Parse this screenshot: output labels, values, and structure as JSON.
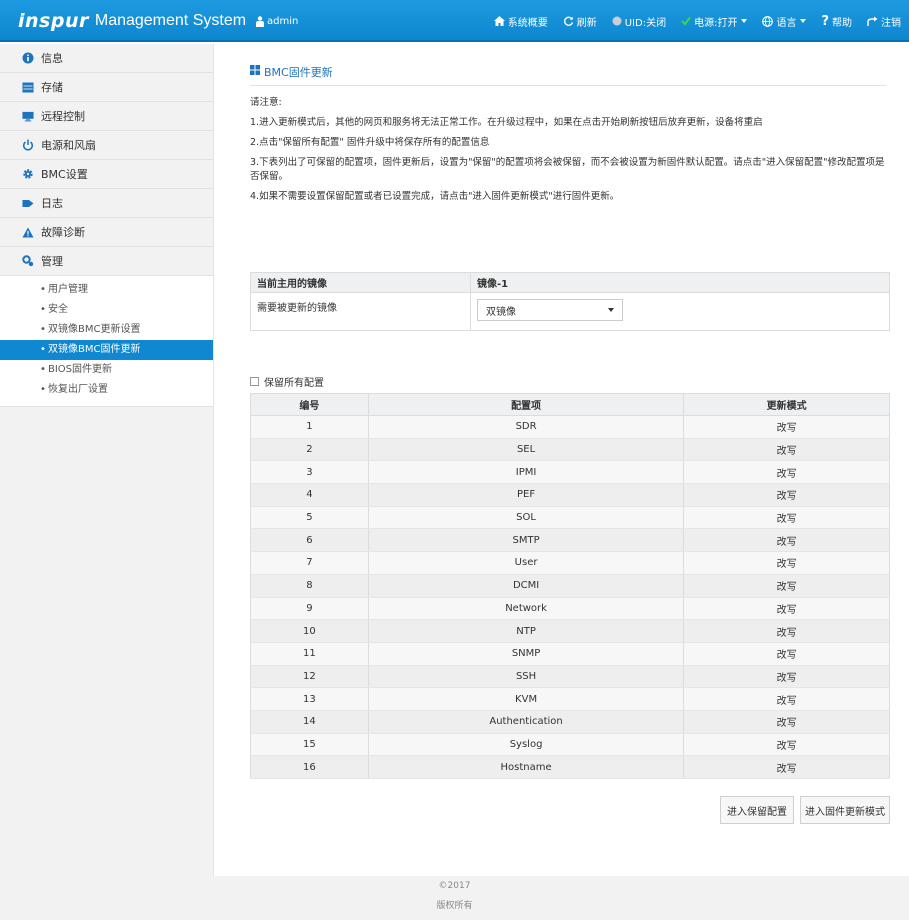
{
  "header": {
    "logo_text": "inspur",
    "system_name": "Management System",
    "user": "admin",
    "nav": [
      {
        "label": "系统概要",
        "icon": "home-icon"
      },
      {
        "label": "刷新",
        "icon": "refresh-icon"
      },
      {
        "label": "UID:关闭",
        "icon": "uid-indicator-icon"
      },
      {
        "label": "电源:打开",
        "icon": "power-check-icon"
      },
      {
        "label": "语言",
        "icon": "globe-icon"
      },
      {
        "label": "帮助",
        "icon": "help-icon"
      },
      {
        "label": "注销",
        "icon": "logout-icon"
      }
    ]
  },
  "sidebar": {
    "items": [
      {
        "label": "信息",
        "icon": "info-icon"
      },
      {
        "label": "存储",
        "icon": "storage-icon"
      },
      {
        "label": "远程控制",
        "icon": "monitor-icon"
      },
      {
        "label": "电源和风扇",
        "icon": "power-icon"
      },
      {
        "label": "BMC设置",
        "icon": "gear-icon"
      },
      {
        "label": "日志",
        "icon": "log-icon"
      },
      {
        "label": "故障诊断",
        "icon": "warning-icon"
      },
      {
        "label": "管理",
        "icon": "manage-icon"
      }
    ],
    "sub_items": [
      {
        "label": "用户管理"
      },
      {
        "label": "安全"
      },
      {
        "label": "双镜像BMC更新设置"
      },
      {
        "label": "双镜像BMC固件更新"
      },
      {
        "label": "BIOS固件更新"
      },
      {
        "label": "恢复出厂设置"
      }
    ]
  },
  "main": {
    "title": "BMC固件更新",
    "notes_heading": "请注意:",
    "notes": [
      "1.进入更新模式后，其他的网页和服务将无法正常工作。在升级过程中，如果在点击开始刷新按钮后放弃更新，设备将重启",
      "2.点击\"保留所有配置\" 固件升级中将保存所有的配置信息",
      "3.下表列出了可保留的配置项，固件更新后，设置为\"保留\"的配置项将会被保留，而不会被设置为新固件默认配置。请点击\"进入保留配置\"修改配置项是否保留。",
      "4.如果不需要设置保留配置或者已设置完成，请点击\"进入固件更新模式\"进行固件更新。"
    ],
    "image_table": {
      "current_label": "当前主用的镜像",
      "current_value": "镜像-1",
      "update_label": "需要被更新的镜像",
      "update_value": "双镜像"
    },
    "keep_all_label": "保留所有配置",
    "config_table": {
      "headers": [
        "编号",
        "配置项",
        "更新模式"
      ],
      "rows": [
        [
          "1",
          "SDR",
          "改写"
        ],
        [
          "2",
          "SEL",
          "改写"
        ],
        [
          "3",
          "IPMI",
          "改写"
        ],
        [
          "4",
          "PEF",
          "改写"
        ],
        [
          "5",
          "SOL",
          "改写"
        ],
        [
          "6",
          "SMTP",
          "改写"
        ],
        [
          "7",
          "User",
          "改写"
        ],
        [
          "8",
          "DCMI",
          "改写"
        ],
        [
          "9",
          "Network",
          "改写"
        ],
        [
          "10",
          "NTP",
          "改写"
        ],
        [
          "11",
          "SNMP",
          "改写"
        ],
        [
          "12",
          "SSH",
          "改写"
        ],
        [
          "13",
          "KVM",
          "改写"
        ],
        [
          "14",
          "Authentication",
          "改写"
        ],
        [
          "15",
          "Syslog",
          "改写"
        ],
        [
          "16",
          "Hostname",
          "改写"
        ]
      ]
    },
    "buttons": {
      "keep_config": "进入保留配置",
      "enter_update": "进入固件更新模式"
    }
  },
  "footer": {
    "copyright": "©2017",
    "rights": "版权所有"
  }
}
